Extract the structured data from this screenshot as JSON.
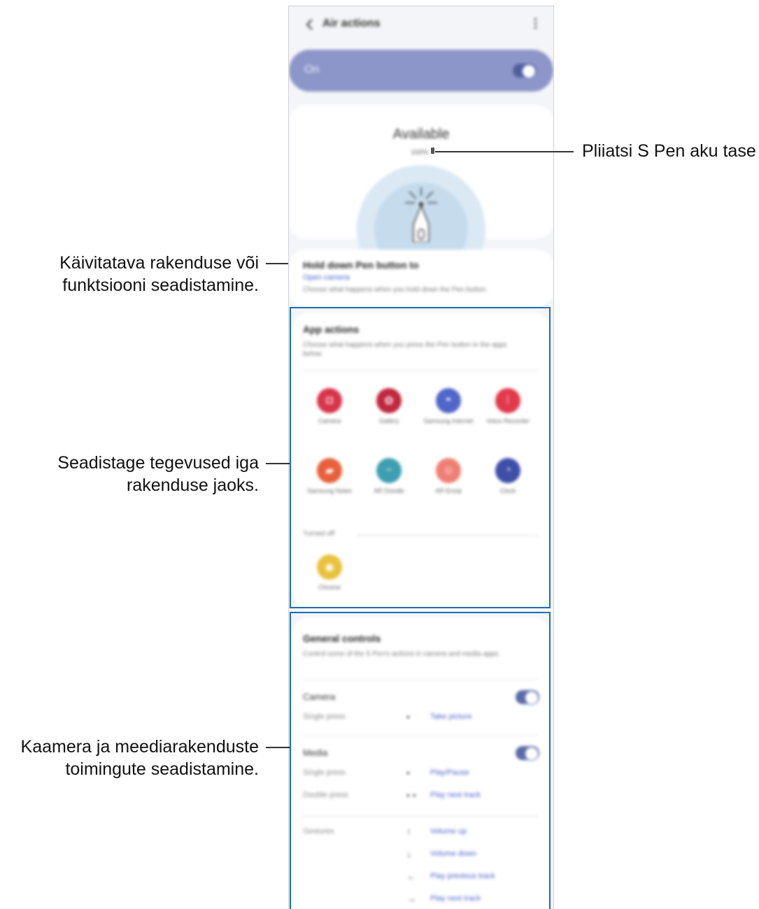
{
  "callouts": {
    "battery_label": "Pliiatsi S Pen aku tase",
    "hold_label_line1": "Käivitatava rakenduse või",
    "hold_label_line2": "funktsiooni seadistamine.",
    "app_label_line1": "Seadistage tegevused iga",
    "app_label_line2": "rakenduse jaoks.",
    "media_label_line1": "Kaamera ja meediarakenduste",
    "media_label_line2": "toimingute seadistamine."
  },
  "screen": {
    "title": "Air actions",
    "master_switch_label": "On",
    "master_switch_state": true,
    "pen": {
      "status": "Available",
      "battery": "100%"
    },
    "hold": {
      "title": "Hold down Pen button to",
      "value": "Open camera",
      "description": "Choose what happens when you hold down the Pen button."
    },
    "app_actions": {
      "title": "App actions",
      "description": "Choose what happens when you press the Pen button in the apps below.",
      "apps": [
        {
          "name": "Camera",
          "icon": "camera-icon",
          "color": "#d9344a",
          "glyph": "◘"
        },
        {
          "name": "Gallery",
          "icon": "gallery-icon",
          "color": "#c0283f",
          "glyph": "✿"
        },
        {
          "name": "Samsung Internet",
          "icon": "internet-icon",
          "color": "#5166c9",
          "glyph": "◓"
        },
        {
          "name": "Voice Recorder",
          "icon": "voice-recorder-icon",
          "color": "#e2394d",
          "glyph": "⁞"
        },
        {
          "name": "Samsung Notes",
          "icon": "notes-icon",
          "color": "#e7603a",
          "glyph": "▰"
        },
        {
          "name": "AR Doodle",
          "icon": "ar-doodle-icon",
          "color": "#3d9fb1",
          "glyph": "~"
        },
        {
          "name": "AR Emoji",
          "icon": "ar-emoji-icon",
          "color": "#ef7f74",
          "glyph": "☺"
        },
        {
          "name": "Clock",
          "icon": "clock-icon",
          "color": "#3e4fa8",
          "glyph": "◔"
        }
      ],
      "turned_off_label": "Turned off",
      "off_apps": [
        {
          "name": "Chrome",
          "icon": "chrome-icon",
          "color": "#e9c13b",
          "glyph": "◉"
        }
      ]
    },
    "general": {
      "title": "General controls",
      "description": "Control some of the S Pen's actions in camera and media apps.",
      "camera": {
        "label": "Camera",
        "enabled": true,
        "rows": [
          {
            "sub": "Single press",
            "gesture": "•",
            "action": "Take picture"
          }
        ]
      },
      "media": {
        "label": "Media",
        "enabled": true,
        "rows": [
          {
            "sub": "Single press",
            "gesture": "•",
            "action": "Play/Pause"
          },
          {
            "sub": "Double press",
            "gesture": "• •",
            "action": "Play next track"
          }
        ]
      },
      "gestures": {
        "label": "Gestures",
        "rows": [
          {
            "gesture": "↑",
            "action": "Volume up"
          },
          {
            "gesture": "↓",
            "action": "Volume down"
          },
          {
            "gesture": "←",
            "action": "Play previous track"
          },
          {
            "gesture": "→",
            "action": "Play next track"
          }
        ]
      }
    }
  },
  "colors": {
    "highlight": "#1b6fb3",
    "accent": "#4b62c8",
    "switch_bar": "#8d96c9"
  }
}
